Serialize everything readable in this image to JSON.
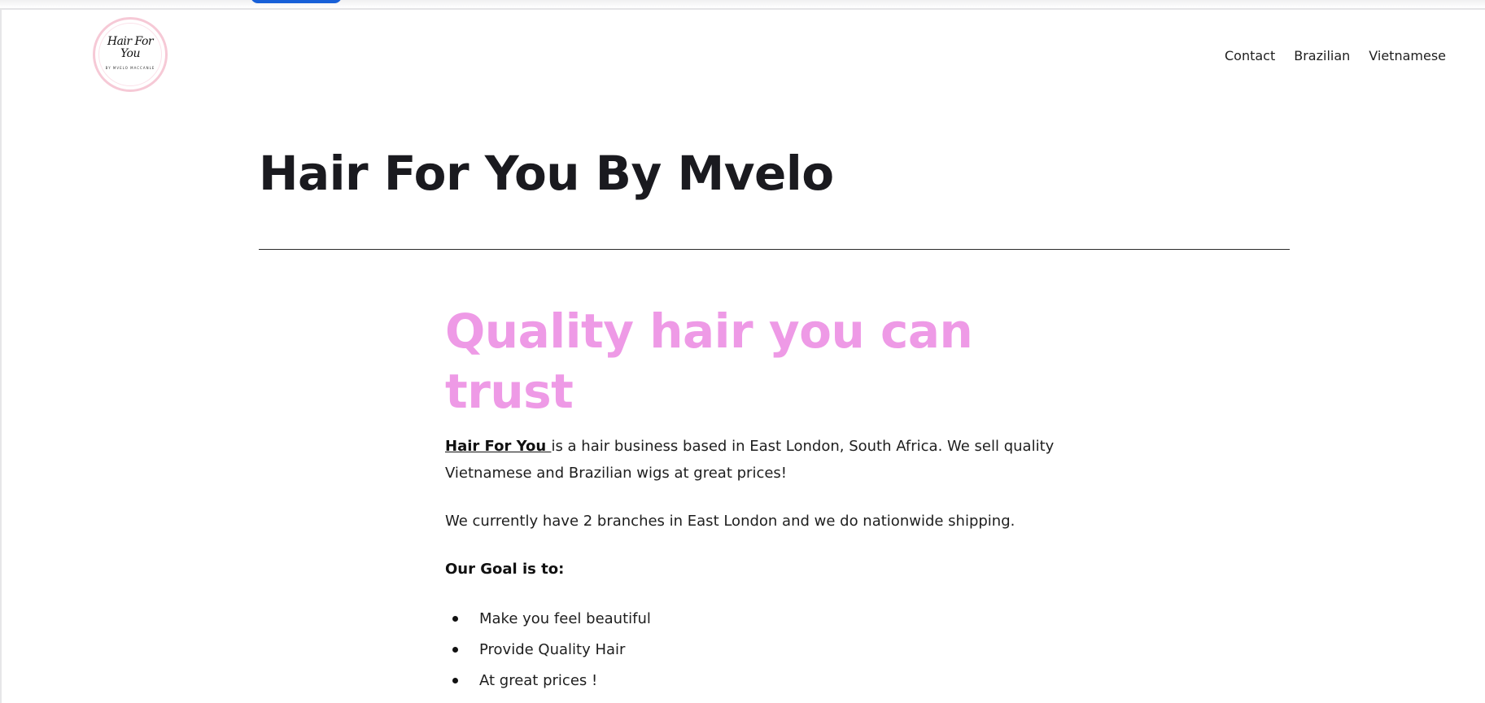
{
  "logo": {
    "line1": "Hair For",
    "line2": "You",
    "subtitle": "BY MVELO MACCANLE"
  },
  "nav": {
    "items": [
      "Contact",
      "Brazilian",
      "Vietnamese"
    ]
  },
  "site_title": "Hair For You By Mvelo",
  "main": {
    "headline": "Quality hair you can trust",
    "intro_link": "Hair For You ",
    "intro_rest": "is a hair business based in East London, South Africa. We sell quality Vietnamese and Brazilian wigs at great prices!",
    "branches": "We currently have 2 branches in East London and we do nationwide shipping.",
    "goal_heading": "Our Goal is to:",
    "goals": [
      "Make you feel beautiful",
      "Provide Quality Hair",
      "At great prices !"
    ]
  },
  "colors": {
    "headline": "#ee9ae6",
    "top_pill": "#1860d8",
    "logo_ring": "#f6c9d6"
  }
}
